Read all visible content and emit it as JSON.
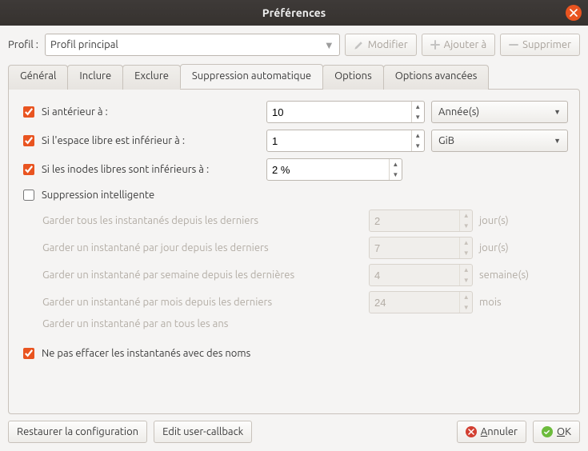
{
  "window": {
    "title": "Préférences"
  },
  "profile": {
    "label": "Profil :",
    "value": "Profil principal",
    "modify": "Modifier",
    "add": "Ajouter à",
    "delete": "Supprimer"
  },
  "tabs": {
    "general": "Général",
    "include": "Inclure",
    "exclude": "Exclure",
    "autoremove": "Suppression automatique",
    "options": "Options",
    "advanced": "Options avancées"
  },
  "autoremove": {
    "older": {
      "label": "Si antérieur à :",
      "value": "10",
      "unit": "Année(s)"
    },
    "freespace": {
      "label": "Si l'espace libre est inférieur à :",
      "value": "1",
      "unit": "GiB"
    },
    "inodes": {
      "label": "Si les inodes libres sont inférieurs à :",
      "value": "2 %"
    },
    "smart": {
      "label": "Suppression intelligente"
    },
    "smart_rows": {
      "all_last": {
        "label": "Garder tous les instantanés depuis les derniers",
        "value": "2",
        "unit": "jour(s)"
      },
      "one_day": {
        "label": "Garder un instantané par jour depuis les derniers",
        "value": "7",
        "unit": "jour(s)"
      },
      "one_week": {
        "label": "Garder un instantané par semaine depuis les dernières",
        "value": "4",
        "unit": "semaine(s)"
      },
      "one_month": {
        "label": "Garder un instantané par mois depuis les derniers",
        "value": "24",
        "unit": "mois"
      },
      "one_year": {
        "label": "Garder un instantané par an tous les ans"
      }
    },
    "keep_named": {
      "label": "Ne pas effacer les instantanés avec des noms"
    }
  },
  "buttons": {
    "restore": "Restaurer la configuration",
    "edit_cb": "Edit user-callback",
    "cancel": "Annuler",
    "ok": "OK"
  }
}
